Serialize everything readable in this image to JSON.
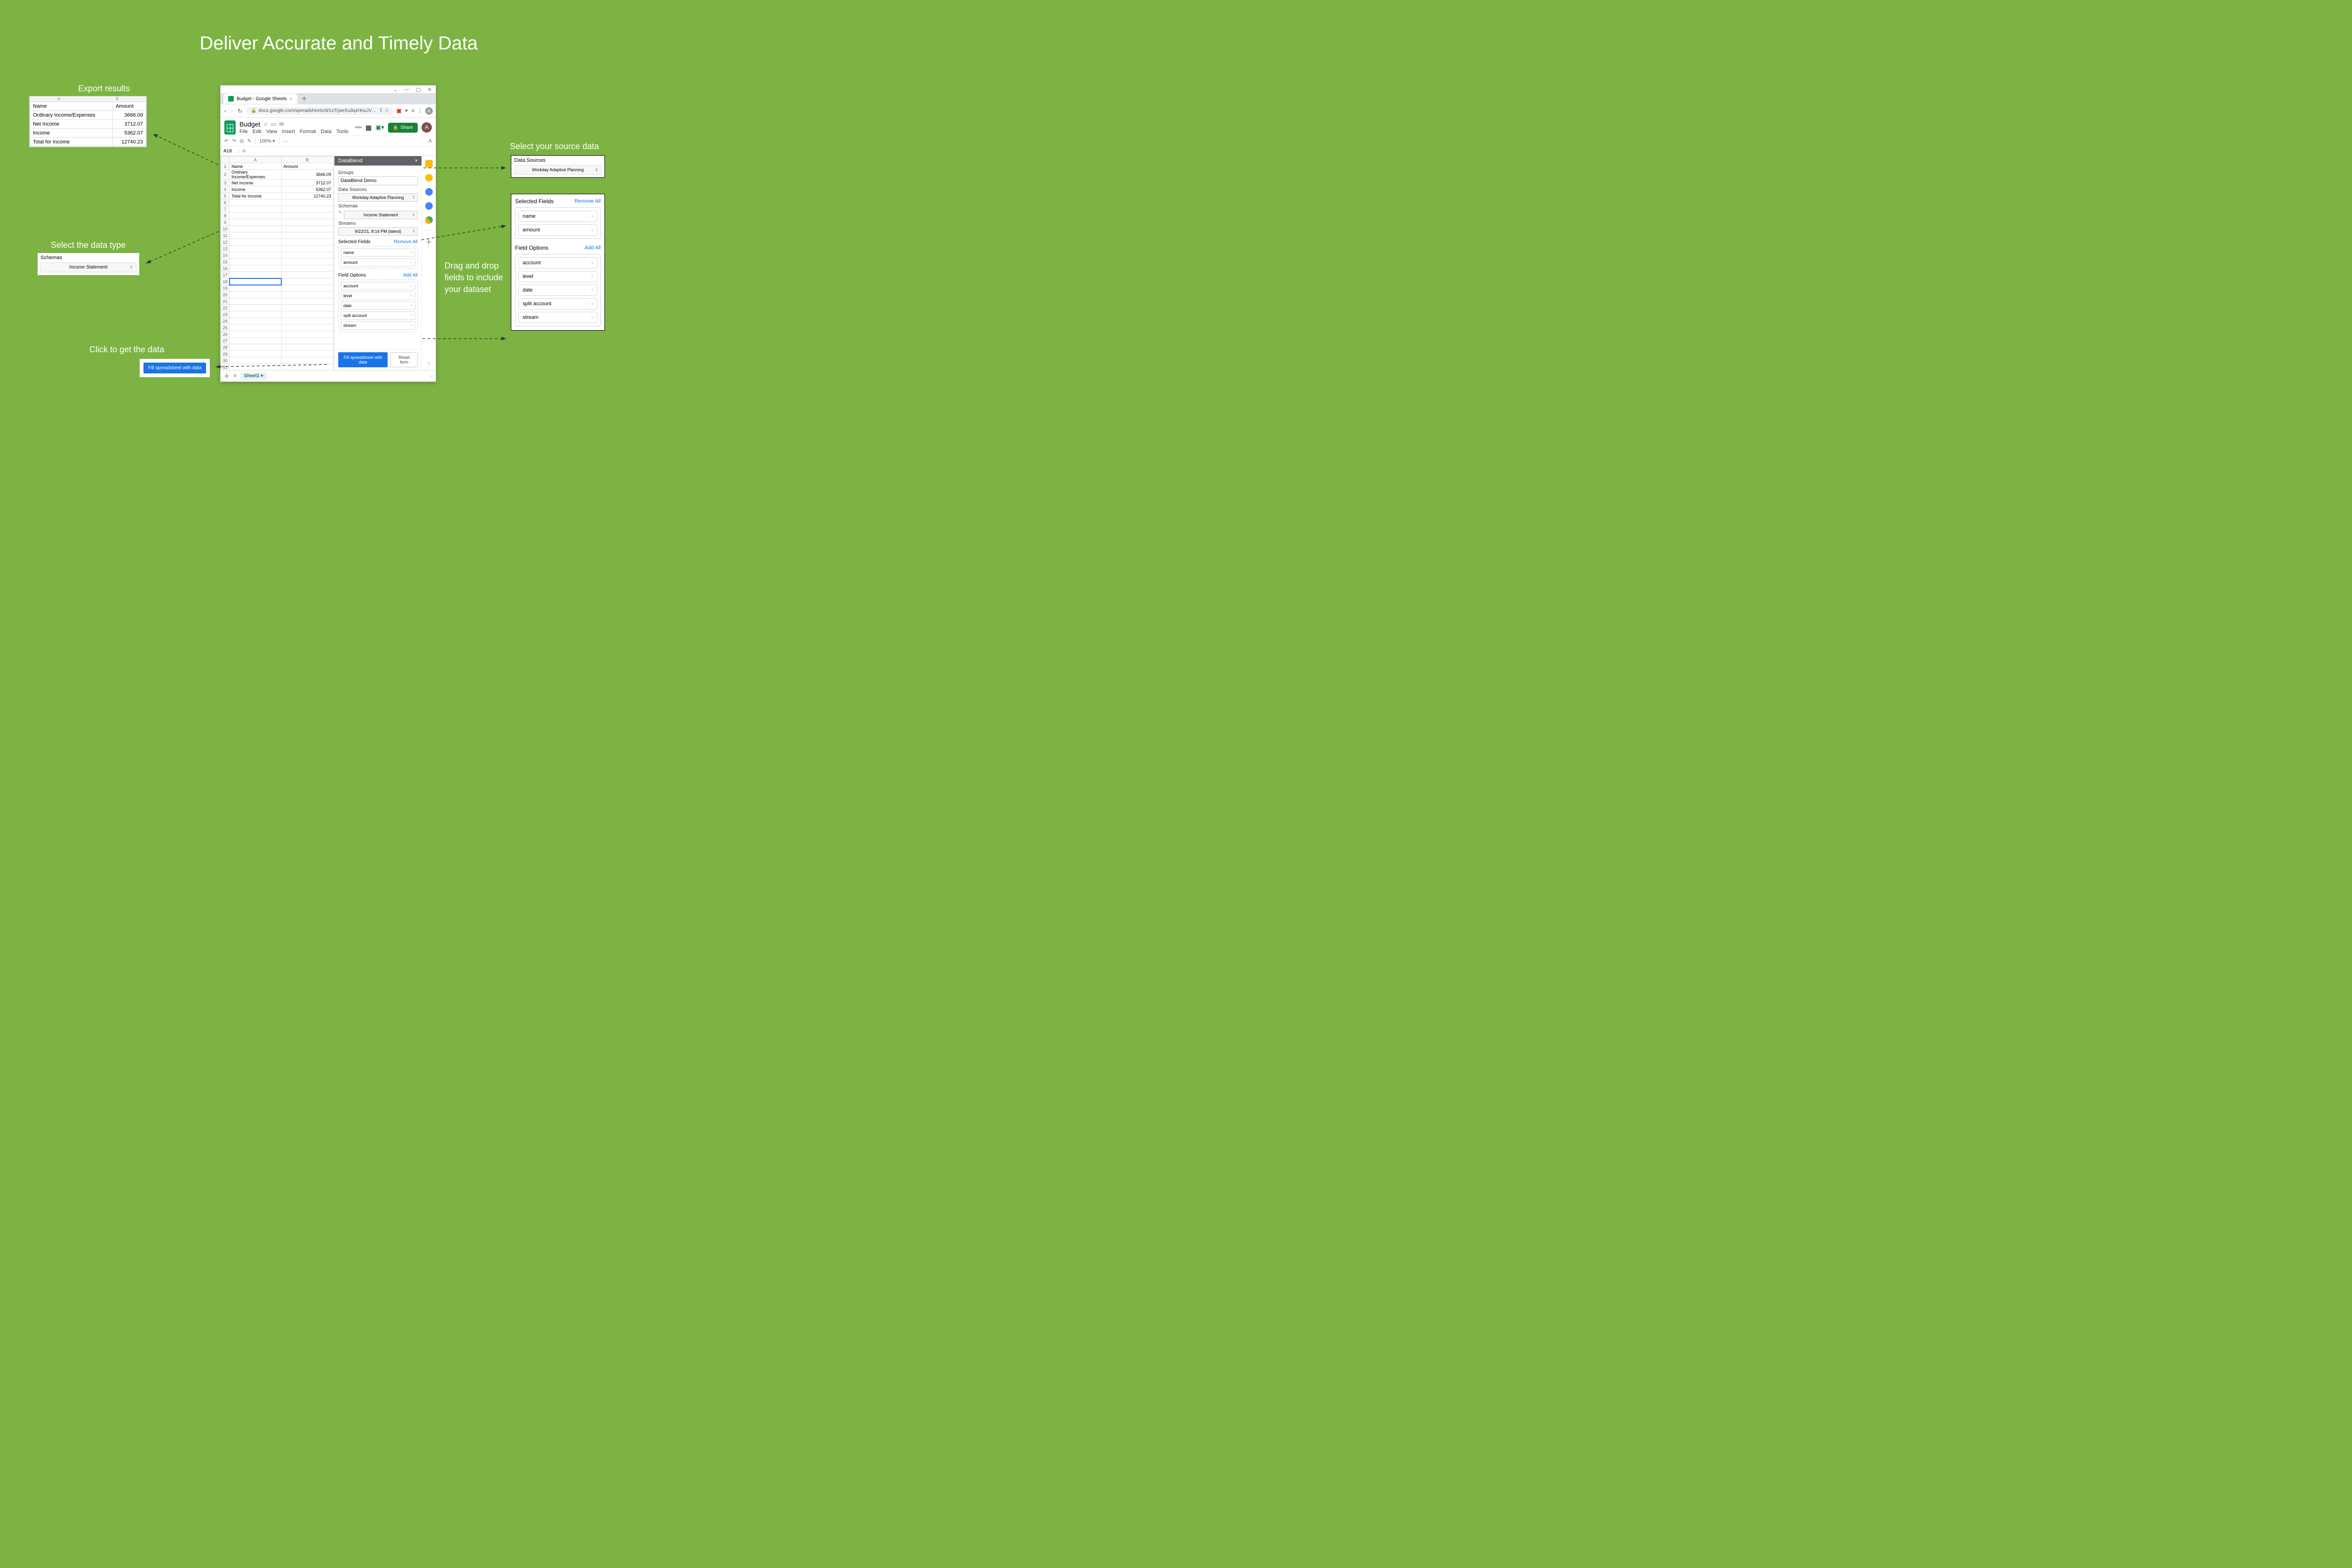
{
  "page_title": "Deliver Accurate and Timely Data",
  "callouts": {
    "export": "Export results",
    "datatype": "Select the data type",
    "click": "Click to get the data",
    "source": "Select your source data",
    "drag": "Drag and drop fields to include your dataset"
  },
  "export_cols": {
    "a": "A",
    "b": "B"
  },
  "export_table": {
    "headers": {
      "name": "Name",
      "amount": "Amount"
    },
    "rows": [
      {
        "name": "Ordinary Income/Expenses",
        "amount": "3666.09"
      },
      {
        "name": "Net Income",
        "amount": "3712.07"
      },
      {
        "name": "Income",
        "amount": "5362.07"
      },
      {
        "name": "Total for Income",
        "amount": "12740.23"
      }
    ]
  },
  "schemas_callout": {
    "label": "Schemas",
    "value": "Income Statement"
  },
  "fill_button": "Fill spreadsheet with data",
  "ds_callout": {
    "label": "Data Sources",
    "value": "Workday Adaptive Planning"
  },
  "fields_callout": {
    "selected_label": "Selected Fields",
    "remove_all": "Remove All",
    "selected": [
      "name",
      "amount"
    ],
    "options_label": "Field Options",
    "add_all": "Add All",
    "options": [
      "account",
      "level",
      "date",
      "split account",
      "stream"
    ]
  },
  "browser": {
    "tab_title": "Budget - Google Sheets",
    "url_lock": "🔒",
    "url": "docs.google.com/spreadsheets/d/1xTrjaeXu3qzHnuJVNK...",
    "url_actions": {
      "share": "⇪",
      "star": "☆"
    },
    "window": {
      "min": "—",
      "max": "▢",
      "close": "✕",
      "drop": "⌄"
    },
    "addr_icons": [
      "‹",
      "›",
      "↻"
    ],
    "avatar": "A",
    "sheets": {
      "title": "Budget",
      "title_icons": [
        "☆",
        "▭",
        "✉"
      ],
      "menu": [
        "File",
        "Edit",
        "View",
        "Insert",
        "Format",
        "Data",
        "Tools"
      ],
      "right_icons": [
        "〰",
        "▦",
        "▣▾"
      ],
      "share": "Share",
      "avatar": "A",
      "toolbar": {
        "undo": "↶",
        "redo": "↷",
        "print": "⎙",
        "paint": "✎",
        "zoom": "100% ▾",
        "more": "···",
        "collapse": "ᐱ"
      },
      "namebox": "A18",
      "fx": "fx",
      "cols": [
        "A",
        "B"
      ],
      "rows_count": 35,
      "data": {
        "1": {
          "A": "Name",
          "B": "Amount"
        },
        "2": {
          "A": "Ordinary Income/Expenses",
          "B": "3666.09"
        },
        "3": {
          "A": "Net Income",
          "B": "3712.07"
        },
        "4": {
          "A": "Income",
          "B": "5362.07"
        },
        "5": {
          "A": "Total for Income",
          "B": "12740.23"
        }
      },
      "selected_cell": "A18",
      "footer": {
        "plus": "＋",
        "menu": "≡",
        "tab": "Sheet1 ▾"
      }
    },
    "plugin": {
      "title": "DataBlend",
      "groups_label": "Groups",
      "groups_value": "DataBlend Demo",
      "ds_label": "Data Sources",
      "ds_value": "Workday Adaptive Planning",
      "schemas_label": "Schemas",
      "schemas_value": "Income Statement",
      "streams_label": "Streams",
      "streams_value": "9/22/21, 8:14 PM (latest)",
      "selected_label": "Selected Fields",
      "remove_all": "Remove All",
      "selected": [
        "name",
        "amount"
      ],
      "options_label": "Field Options",
      "add_all": "Add All",
      "options": [
        "account",
        "level",
        "date",
        "split account",
        "stream"
      ],
      "fill": "Fill spreadsheet with data",
      "reset": "Reset form"
    },
    "side_rail_plus": "＋"
  }
}
